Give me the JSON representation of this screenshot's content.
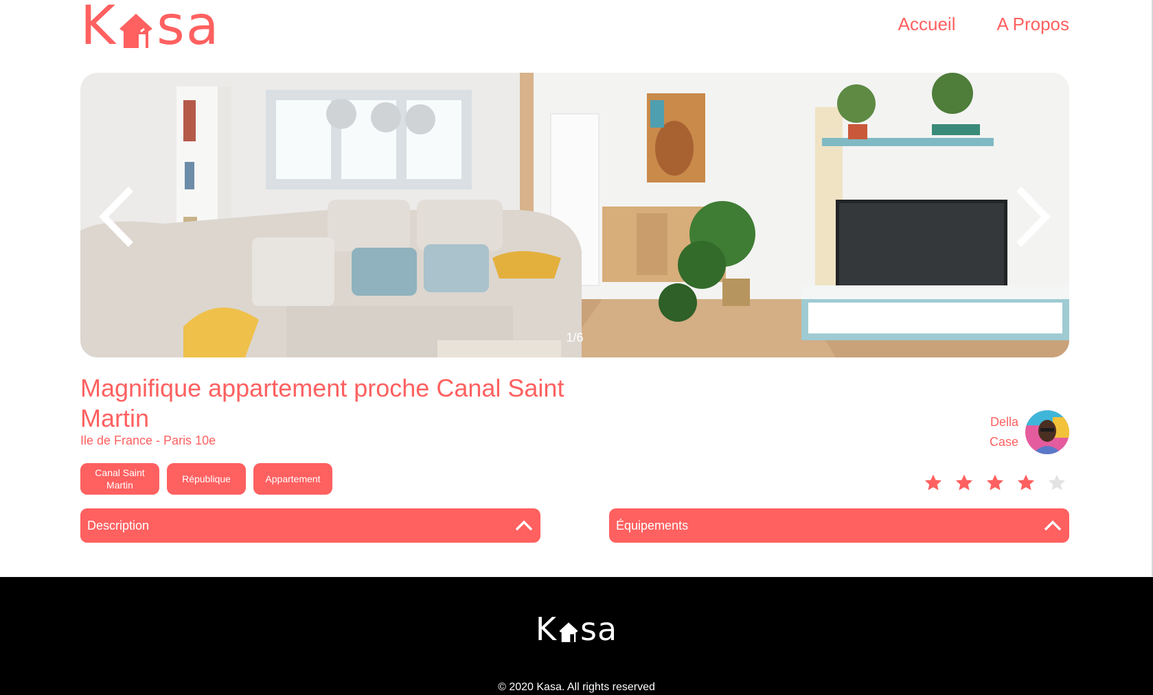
{
  "header": {
    "logo": {
      "first": "K",
      "rest": "sa"
    },
    "nav": [
      {
        "label": "Accueil"
      },
      {
        "label": "A Propos"
      }
    ]
  },
  "carousel": {
    "counter": "1/6",
    "current": 1,
    "total": 6
  },
  "listing": {
    "title": "Magnifique appartement proche Canal Saint Martin",
    "location": "Ile de France - Paris 10e",
    "tags": [
      "Canal Saint Martin",
      "République",
      "Appartement"
    ],
    "host": {
      "first_name": "Della",
      "last_name": "Case"
    },
    "rating": 4,
    "rating_max": 5
  },
  "collapses": {
    "description": "Description",
    "equipments": "Équipements"
  },
  "footer": {
    "logo": {
      "first": "K",
      "rest": "sa"
    },
    "copyright": "© 2020 Kasa. All rights reserved"
  },
  "colors": {
    "brand": "#FF6060",
    "star_off": "#E3E3E3",
    "footer_bg": "#000000"
  }
}
